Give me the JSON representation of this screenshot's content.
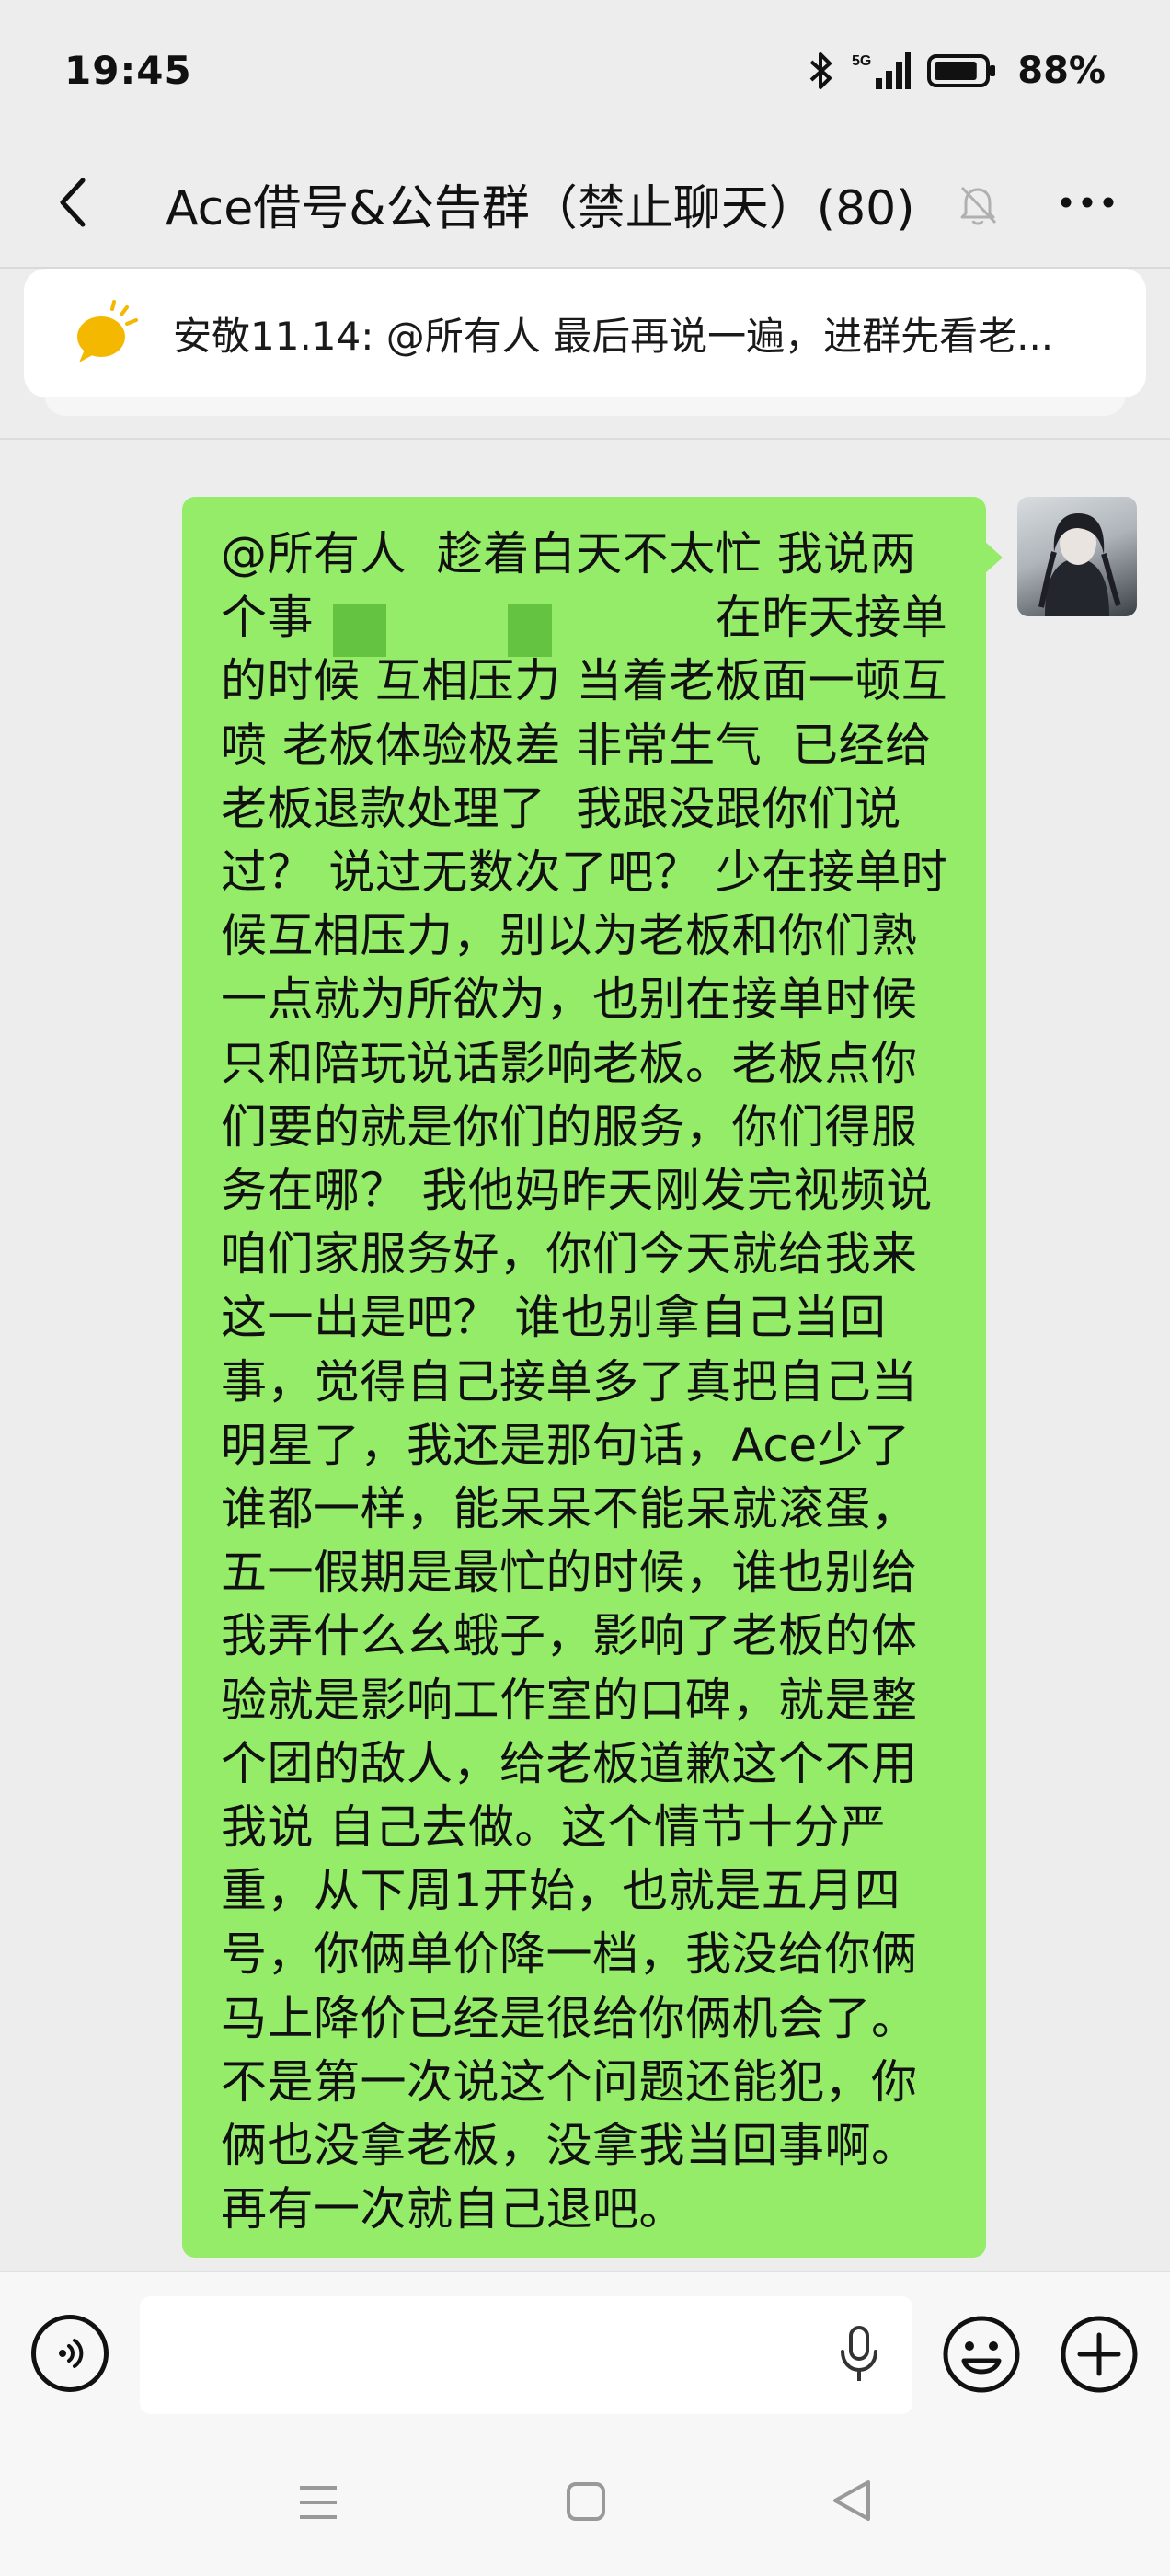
{
  "status_bar": {
    "time": "19:45",
    "network": "5G",
    "battery_percent": "88%",
    "battery_level": 0.88
  },
  "header": {
    "title": "Ace借号&公告群（禁止聊天）(80)",
    "back_icon": "chevron-left-icon",
    "mute_icon": "bell-off-icon",
    "more_icon": "more-dots-icon"
  },
  "announcement": {
    "icon": "megaphone-icon",
    "icon_color": "#f5b800",
    "text": "安敬11.14: @所有人 最后再说一遍，进群先看老..."
  },
  "message": {
    "bubble_color": "#95ec69",
    "text": "@所有人  趁着白天不太忙 我说两个事 　　　　　　　　 在昨天接单的时候 互相压力 当着老板面一顿互喷 老板体验极差 非常生气  已经给老板退款处理了  我跟没跟你们说过？ 说过无数次了吧？ 少在接单时候互相压力，别以为老板和你们熟一点就为所欲为，也别在接单时候只和陪玩说话影响老板。老板点你们要的就是你们的服务，你们得服务在哪？ 我他妈昨天刚发完视频说咱们家服务好，你们今天就给我来这一出是吧？ 谁也别拿自己当回事，觉得自己接单多了真把自己当明星了，我还是那句话，Ace少了谁都一样，能呆呆不能呆就滚蛋，五一假期是最忙的时候，谁也别给我弄什么幺蛾子，影响了老板的体验就是影响工作室的口碑，就是整个团的敌人，给老板道歉这个不用我说 自己去做。这个情节十分严重，从下周1开始，也就是五月四号，你俩单价降一档，我没给你俩马上降价已经是很给你俩机会了。不是第一次说这个问题还能犯，你俩也没拿老板，没拿我当回事啊。再有一次就自己退吧。"
  },
  "input_bar": {
    "voice_icon": "voice-icon",
    "mic_icon": "microphone-icon",
    "emoji_icon": "emoji-icon",
    "plus_icon": "plus-icon",
    "placeholder": ""
  },
  "nav_bar": {
    "menu_icon": "menu-icon",
    "home_icon": "home-square-icon",
    "back_icon": "back-triangle-icon"
  }
}
